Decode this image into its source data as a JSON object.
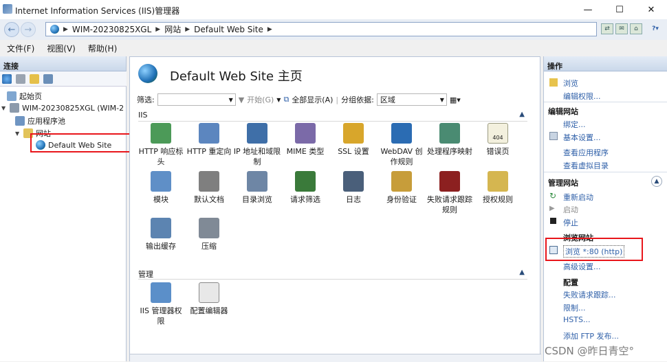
{
  "window": {
    "title": "Internet Information Services (IIS)管理器",
    "minimize": "—",
    "maximize": "☐",
    "close": "✕"
  },
  "address": {
    "crumbs": [
      "WIM-20230825XGL",
      "网站",
      "Default Web Site"
    ]
  },
  "menu": [
    "文件(F)",
    "视图(V)",
    "帮助(H)"
  ],
  "connections": {
    "header": "连接",
    "tree": [
      {
        "label": "起始页"
      },
      {
        "label": "WIM-20230825XGL (WIM-2"
      },
      {
        "label": "应用程序池"
      },
      {
        "label": "网站"
      },
      {
        "label": "Default Web Site"
      }
    ]
  },
  "center": {
    "title": "Default Web Site 主页",
    "filter": {
      "label": "筛选:",
      "start": "开始(G)",
      "showall": "全部显示(A)",
      "groupby": "分组依据:",
      "group_value": "区域"
    },
    "groups": [
      {
        "name": "IIS",
        "features": [
          "HTTP 响应标头",
          "HTTP 重定向",
          "IP 地址和域限制",
          "MIME 类型",
          "SSL 设置",
          "WebDAV 创作规则",
          "处理程序映射",
          "错误页",
          "模块",
          "默认文档",
          "目录浏览",
          "请求筛选",
          "日志",
          "身份验证",
          "失败请求跟踪规则",
          "授权规则",
          "输出缓存",
          "压缩"
        ]
      },
      {
        "name": "管理",
        "features": [
          "IIS 管理器权限",
          "配置编辑器"
        ]
      }
    ],
    "error_icon_text": "404"
  },
  "actions": {
    "header": "操作",
    "explore": "浏览",
    "edit_permissions": "编辑权限...",
    "edit_site": "编辑网站",
    "bindings": "绑定...",
    "basic_settings": "基本设置...",
    "view_apps": "查看应用程序",
    "view_vdirs": "查看虚拟目录",
    "manage_site": "管理网站",
    "restart": "重新启动",
    "start": "启动",
    "stop": "停止",
    "browse_site": "浏览网站",
    "browse_80": "浏览 *:80 (http)",
    "advanced": "高级设置...",
    "configure": "配置",
    "failed_tracing": "失败请求跟踪...",
    "limits": "限制...",
    "hsts": "HSTS...",
    "add_ftp": "添加 FTP 发布..."
  },
  "watermark": "CSDN @昨日青空°",
  "colors": {
    "accent": "#2e5fa8",
    "highlight": "#e8151a"
  }
}
